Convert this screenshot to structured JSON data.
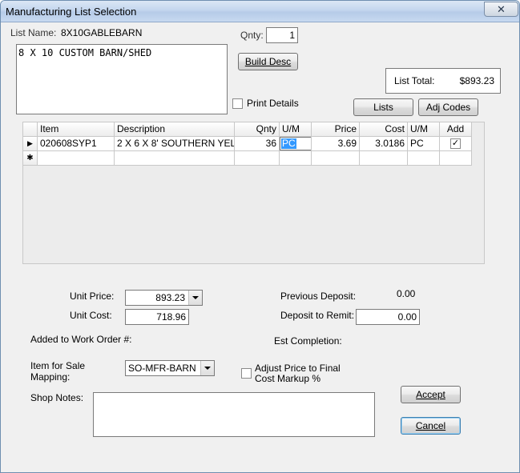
{
  "window": {
    "title": "Manufacturing List Selection",
    "close_glyph": "✕"
  },
  "list_name": {
    "label": "List Name:",
    "value": "8X10GABLEBARN"
  },
  "description_text": "8 X 10 CUSTOM BARN/SHED",
  "qnty": {
    "label": "Qnty:",
    "value": "1"
  },
  "buttons": {
    "build_desc": "Build Desc",
    "lists": "Lists",
    "adj_codes": "Adj Codes",
    "accept": "Accept",
    "cancel": "Cancel"
  },
  "list_total": {
    "label": "List Total:",
    "value": "$893.23"
  },
  "print_details": {
    "label": "Print Details",
    "checked": false
  },
  "grid": {
    "headers": [
      "Item",
      "Description",
      "Qnty",
      "U/M",
      "Price",
      "Cost",
      "U/M",
      "Add"
    ],
    "rows": [
      {
        "item": "020608SYP1",
        "description": "2 X 6 X 8' SOUTHERN YEL",
        "qnty": "36",
        "um": "PC",
        "price": "3.69",
        "cost": "3.0186",
        "um2": "PC",
        "add": true
      }
    ],
    "current_row_marker": "▶",
    "new_row_marker": "✱"
  },
  "unit_price": {
    "label": "Unit Price:",
    "value": "893.23"
  },
  "unit_cost": {
    "label": "Unit Cost:",
    "value": "718.96"
  },
  "previous_deposit": {
    "label": "Previous Deposit:",
    "value": "0.00"
  },
  "deposit_to_remit": {
    "label": "Deposit to Remit:",
    "value": "0.00"
  },
  "added_to_work_order": {
    "label": "Added to Work Order #:"
  },
  "est_completion": {
    "label": "Est Completion:"
  },
  "item_for_sale": {
    "label_line1": "Item for Sale",
    "label_line2": "Mapping:",
    "value": "SO-MFR-BARN"
  },
  "adjust_price": {
    "label_line1": "Adjust Price to Final",
    "label_line2": "Cost Markup %",
    "checked": false
  },
  "shop_notes": {
    "label": "Shop Notes:",
    "value": ""
  },
  "colors": {
    "selection": "#3399ff",
    "titlebar": "#c3d6ee"
  }
}
